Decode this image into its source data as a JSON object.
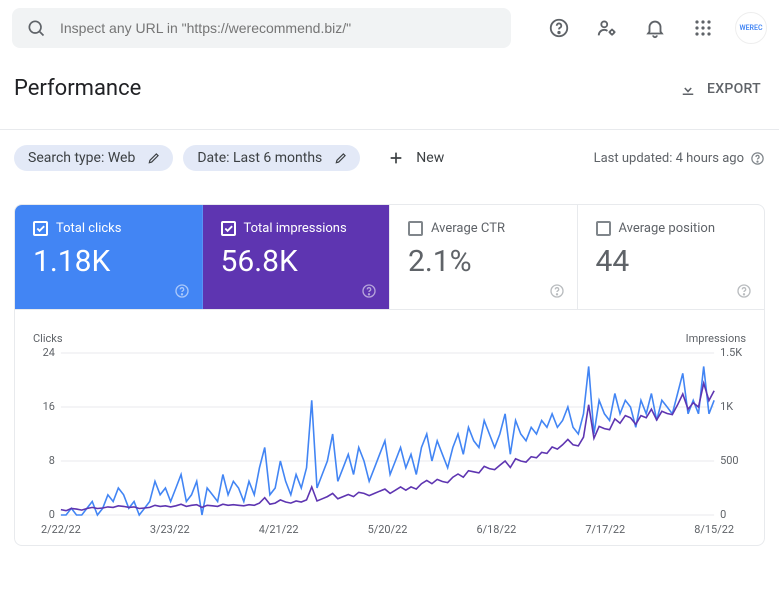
{
  "topbar": {
    "search_placeholder": "Inspect any URL in \"https://werecommend.biz/\"",
    "avatar_text": "WEREC"
  },
  "header": {
    "title": "Performance",
    "export_label": "EXPORT"
  },
  "filters": {
    "chip_search": "Search type: Web",
    "chip_date": "Date: Last 6 months",
    "new_label": "New",
    "updated_label": "Last updated: 4 hours ago"
  },
  "metrics": {
    "clicks_label": "Total clicks",
    "clicks_value": "1.18K",
    "impr_label": "Total impressions",
    "impr_value": "56.8K",
    "ctr_label": "Average CTR",
    "ctr_value": "2.1%",
    "pos_label": "Average position",
    "pos_value": "44"
  },
  "chart_data": {
    "type": "line",
    "y_left_label": "Clicks",
    "y_right_label": "Impressions",
    "y_left_ticks": [
      0,
      8,
      16,
      24
    ],
    "y_right_ticks": [
      0,
      500,
      "1K",
      "1.5K"
    ],
    "x_ticks": [
      "2/22/22",
      "3/23/22",
      "4/21/22",
      "5/20/22",
      "6/18/22",
      "7/17/22",
      "8/15/22"
    ],
    "ylim_left": [
      0,
      24
    ],
    "ylim_right": [
      0,
      1500
    ],
    "series": [
      {
        "name": "Clicks",
        "color": "#4285f4",
        "values": [
          0,
          0,
          1,
          0,
          0,
          1,
          2,
          0,
          1,
          3,
          2,
          4,
          3,
          1,
          2,
          0,
          1,
          2,
          5,
          3,
          4,
          2,
          4,
          6,
          2,
          3,
          5,
          0,
          4,
          3,
          2,
          6,
          3,
          5,
          4,
          2,
          5,
          3,
          7,
          10,
          3,
          4,
          8,
          5,
          3,
          6,
          4,
          7,
          17,
          4,
          6,
          8,
          12,
          5,
          7,
          9,
          6,
          10,
          8,
          5,
          7,
          9,
          11,
          6,
          8,
          10,
          7,
          9,
          6,
          10,
          12,
          8,
          11,
          9,
          7,
          10,
          12,
          9,
          13,
          11,
          10,
          14,
          12,
          10,
          12,
          15,
          9,
          14,
          12,
          11,
          13,
          12,
          14,
          13,
          15,
          13,
          14,
          16,
          13,
          12,
          15,
          22,
          12,
          17,
          15,
          14,
          18,
          15,
          17,
          16,
          13,
          17,
          15,
          18,
          14,
          17,
          16,
          15,
          18,
          21,
          15,
          17,
          15,
          22,
          15,
          17
        ]
      },
      {
        "name": "Impressions",
        "color": "#5e35b1",
        "values": [
          50,
          40,
          60,
          55,
          45,
          60,
          70,
          60,
          65,
          75,
          70,
          85,
          80,
          70,
          75,
          60,
          65,
          70,
          90,
          80,
          85,
          75,
          85,
          100,
          80,
          90,
          95,
          70,
          90,
          85,
          80,
          100,
          90,
          95,
          90,
          85,
          95,
          90,
          110,
          160,
          100,
          110,
          140,
          120,
          110,
          130,
          120,
          140,
          260,
          130,
          150,
          170,
          200,
          150,
          170,
          190,
          170,
          210,
          200,
          180,
          200,
          220,
          240,
          200,
          230,
          260,
          230,
          260,
          240,
          290,
          320,
          290,
          330,
          310,
          300,
          350,
          380,
          350,
          410,
          400,
          390,
          450,
          430,
          420,
          460,
          500,
          440,
          520,
          500,
          490,
          540,
          530,
          580,
          570,
          630,
          610,
          650,
          700,
          650,
          640,
          720,
          1020,
          710,
          820,
          800,
          790,
          890,
          850,
          920,
          900,
          840,
          920,
          900,
          980,
          880,
          960,
          940,
          930,
          1020,
          1120,
          980,
          1040,
          1000,
          1220,
          1060,
          1150
        ]
      }
    ]
  }
}
